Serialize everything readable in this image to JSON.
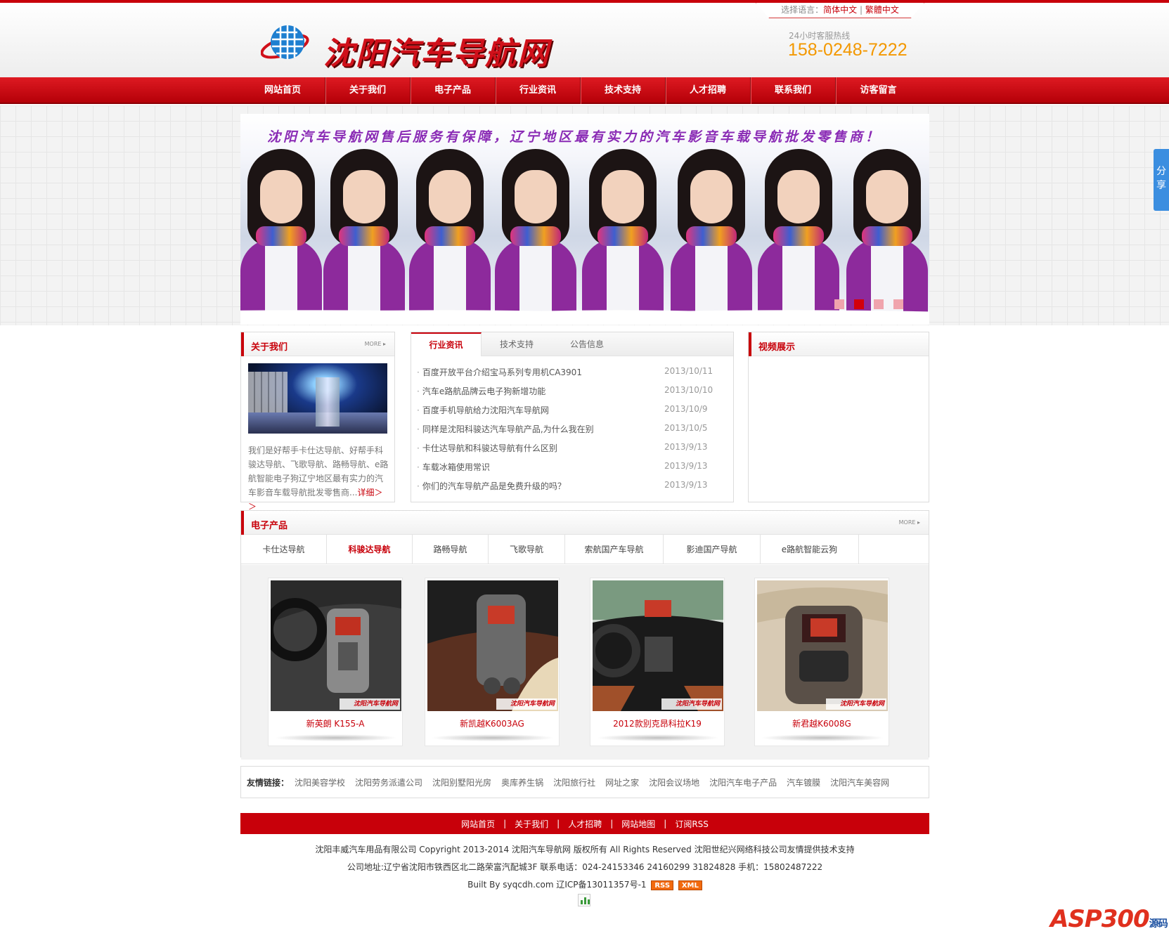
{
  "lang": {
    "label": "选择语言：",
    "simplified": "简体中文",
    "sep": "|",
    "traditional": "繁體中文"
  },
  "header": {
    "logo_text": "沈阳汽车导航网",
    "hotline_label": "24小时客服热线",
    "hotline_number": "158-0248-7222"
  },
  "nav": [
    "网站首页",
    "关于我们",
    "电子产品",
    "行业资讯",
    "技术支持",
    "人才招聘",
    "联系我们",
    "访客留言"
  ],
  "banner": {
    "slogan": "沈阳汽车导航网售后服务有保障，辽宁地区最有实力的汽车影音车载导航批发零售商！",
    "slide_count": 4,
    "active_slide": 2
  },
  "share": {
    "label": "分享"
  },
  "about": {
    "title": "关于我们",
    "more": "MORE",
    "text": "我们是好帮手卡仕达导航、好帮手科骏达导航、飞歌导航、路畅导航、e路航智能电子狗辽宁地区最有实力的汽车影音车载导航批发零售商...",
    "detail": "详细＞＞"
  },
  "news": {
    "tabs": [
      "行业资讯",
      "技术支持",
      "公告信息"
    ],
    "items": [
      {
        "title": "百度开放平台介绍宝马系列专用机CA3901",
        "date": "2013/10/11"
      },
      {
        "title": "汽车e路航品牌云电子狗新增功能",
        "date": "2013/10/10"
      },
      {
        "title": "百度手机导航给力沈阳汽车导航网",
        "date": "2013/10/9"
      },
      {
        "title": "同样是沈阳科骏达汽车导航产品,为什么我在别",
        "date": "2013/10/5"
      },
      {
        "title": "卡仕达导航和科骏达导航有什么区别",
        "date": "2013/9/13"
      },
      {
        "title": "车载冰箱使用常识",
        "date": "2013/9/13"
      },
      {
        "title": "你们的汽车导航产品是免费升级的吗？",
        "date": "2013/9/13"
      }
    ]
  },
  "video": {
    "title": "视频展示"
  },
  "products": {
    "title": "电子产品",
    "more": "MORE",
    "tabs": [
      "卡仕达导航",
      "科骏达导航",
      "路畅导航",
      "飞歌导航",
      "索航国产车导航",
      "影迪国产导航",
      "e路航智能云狗"
    ],
    "active_tab": 1,
    "items": [
      {
        "name": "新英朗 K155-A",
        "watermark": "沈阳汽车导航网"
      },
      {
        "name": "新凯越K6003AG",
        "watermark": "沈阳汽车导航网"
      },
      {
        "name": "2012款别克昂科拉K19",
        "watermark": "沈阳汽车导航网"
      },
      {
        "name": "新君越K6008G",
        "watermark": "沈阳汽车导航网"
      }
    ]
  },
  "links": {
    "label": "友情链接：",
    "items": [
      "沈阳美容学校",
      "沈阳劳务派遣公司",
      "沈阳别墅阳光房",
      "奥库养生锅",
      "沈阳旅行社",
      "网址之家",
      "沈阳会议场地",
      "沈阳汽车电子产品",
      "汽车镀膜",
      "沈阳汽车美容网"
    ]
  },
  "footer": {
    "nav": [
      "网站首页",
      "关于我们",
      "人才招聘",
      "网站地图",
      "订阅RSS"
    ],
    "sep": "|",
    "copyright": "沈阳丰威汽车用品有限公司 Copyright 2013-2014 沈阳汽车导航网 版权所有 All Rights Reserved 沈阳世纪兴网络科技公司友情提供技术支持",
    "address": "公司地址:辽宁省沈阳市铁西区北二路荣富汽配城3F 联系电话：024-24153346 24160299 31824828 手机：15802487222",
    "built": "Built By syqcdh.com 辽ICP备13011357号-1",
    "rss": "RSS",
    "xml": "XML"
  },
  "watermark_logo": {
    "main": "ASP300",
    "tail": "源码 .com"
  },
  "colors": {
    "brand_red": "#c8000a",
    "hotline_orange": "#f39800",
    "share_blue": "#3b8ee0"
  }
}
